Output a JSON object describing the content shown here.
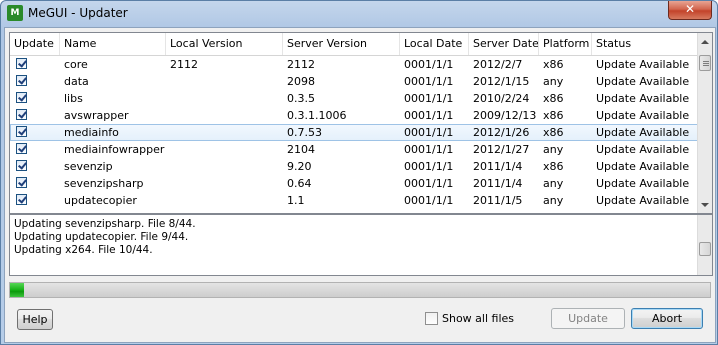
{
  "window": {
    "title": "MeGUI - Updater",
    "icon_letter": "M",
    "close_glyph": "✕"
  },
  "table": {
    "columns": [
      "Update",
      "Name",
      "Local Version",
      "Server Version",
      "Local Date",
      "Server Date",
      "Platform",
      "Status"
    ],
    "rows": [
      {
        "checked": true,
        "name": "core",
        "local_version": "2112",
        "server_version": "2112",
        "local_date": "0001/1/1",
        "server_date": "2012/2/7",
        "platform": "x86",
        "status": "Update Available"
      },
      {
        "checked": true,
        "name": "data",
        "local_version": "",
        "server_version": "2098",
        "local_date": "0001/1/1",
        "server_date": "2012/1/15",
        "platform": "any",
        "status": "Update Available"
      },
      {
        "checked": true,
        "name": "libs",
        "local_version": "",
        "server_version": "0.3.5",
        "local_date": "0001/1/1",
        "server_date": "2010/2/24",
        "platform": "x86",
        "status": "Update Available"
      },
      {
        "checked": true,
        "name": "avswrapper",
        "local_version": "",
        "server_version": "0.3.1.1006",
        "local_date": "0001/1/1",
        "server_date": "2009/12/13",
        "platform": "x86",
        "status": "Update Available"
      },
      {
        "checked": true,
        "name": "mediainfo",
        "local_version": "",
        "server_version": "0.7.53",
        "local_date": "0001/1/1",
        "server_date": "2012/1/26",
        "platform": "x86",
        "status": "Update Available",
        "selected": true
      },
      {
        "checked": true,
        "name": "mediainfowrapper",
        "local_version": "",
        "server_version": "2104",
        "local_date": "0001/1/1",
        "server_date": "2012/1/27",
        "platform": "any",
        "status": "Update Available"
      },
      {
        "checked": true,
        "name": "sevenzip",
        "local_version": "",
        "server_version": "9.20",
        "local_date": "0001/1/1",
        "server_date": "2011/1/4",
        "platform": "x86",
        "status": "Update Available"
      },
      {
        "checked": true,
        "name": "sevenzipsharp",
        "local_version": "",
        "server_version": "0.64",
        "local_date": "0001/1/1",
        "server_date": "2011/1/4",
        "platform": "any",
        "status": "Update Available"
      },
      {
        "checked": true,
        "name": "updatecopier",
        "local_version": "",
        "server_version": "1.1",
        "local_date": "0001/1/1",
        "server_date": "2011/1/5",
        "platform": "any",
        "status": "Update Available"
      }
    ]
  },
  "log": {
    "lines": [
      "Updating sevenzipsharp. File 8/44.",
      "Updating updatecopier. File 9/44.",
      "Updating x264. File 10/44."
    ]
  },
  "progress": {
    "fraction": 0.02,
    "color": "#16b116"
  },
  "buttons": {
    "help": "Help",
    "show_all_files": "Show all files",
    "show_all_checked": false,
    "update": "Update",
    "update_enabled": false,
    "abort": "Abort"
  }
}
